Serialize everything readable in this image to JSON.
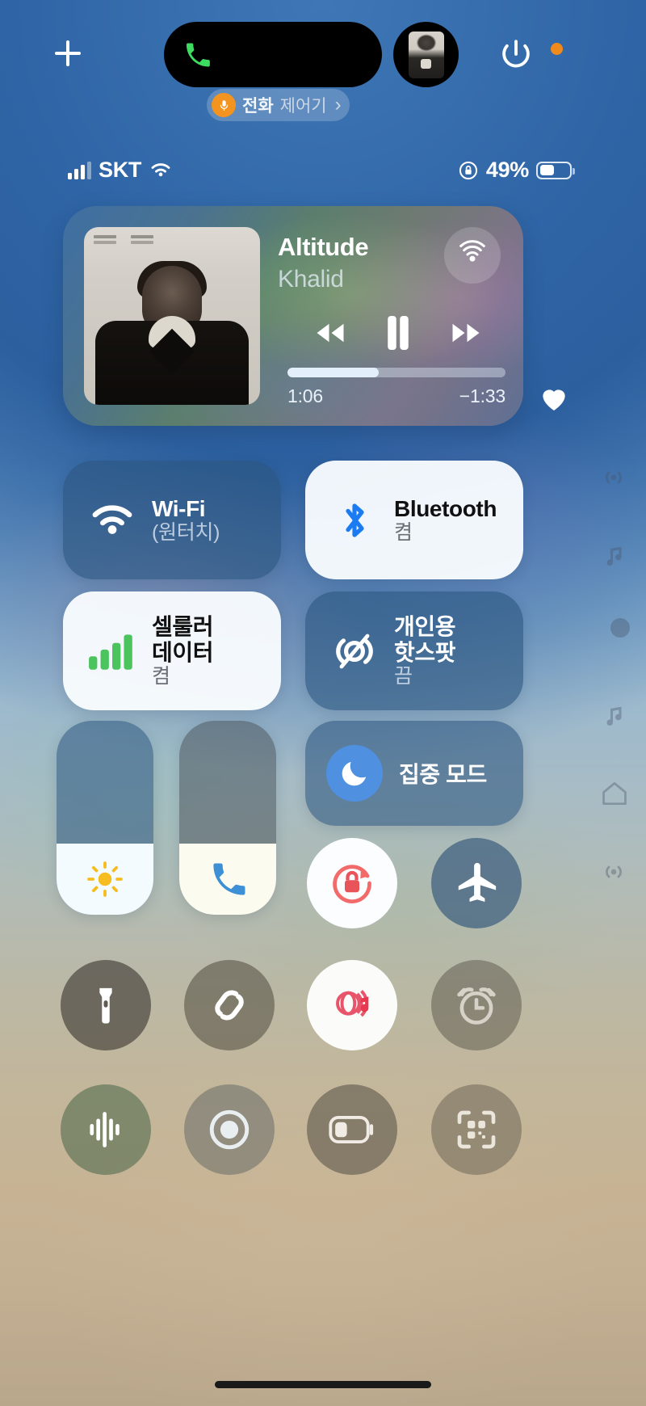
{
  "topbar": {
    "add_button_label": "+",
    "dynamic_island": {
      "name": "phone-call-activity",
      "icon": "phone-icon",
      "avatar": "caller-avatar"
    },
    "power_icon": "power-icon",
    "orange_dot": "microphone-in-use-indicator",
    "phone_pill": {
      "icon": "microphone-icon",
      "label": "전화",
      "sub_label": "제어기",
      "chevron": "›"
    }
  },
  "statusbar": {
    "signal": "cellular-signal-bars",
    "carrier": "SKT",
    "wifi": "wifi-icon",
    "orientation_lock": "rotation-lock-icon",
    "battery_percent": "49%",
    "battery_level": 49
  },
  "media": {
    "title": "Altitude",
    "artist": "Khalid",
    "airplay_icon": "airplay-icon",
    "rewind_icon": "rewind-icon",
    "play_pause_icon": "pause-icon",
    "forward_icon": "fast-forward-icon",
    "elapsed": "1:06",
    "remaining": "−1:33",
    "progress_percent": 42,
    "favorite_icon": "heart-icon"
  },
  "tiles": [
    {
      "id": "wifi",
      "icon": "wifi-icon",
      "name": "Wi-Fi",
      "state": "(원터치)",
      "style": "dark"
    },
    {
      "id": "bluetooth",
      "icon": "bluetooth-icon",
      "name": "Bluetooth",
      "state": "켬",
      "style": "light"
    },
    {
      "id": "cellular",
      "icon": "cellular-bars-icon",
      "name": "셀룰러\n데이터",
      "name_line1": "셀룰러",
      "name_line2": "데이터",
      "state": "켬",
      "style": "light"
    },
    {
      "id": "hotspot",
      "icon": "hotspot-off-icon",
      "name_line1": "개인용",
      "name_line2": "핫스팟",
      "state": "끔",
      "style": "dark"
    }
  ],
  "sliders": [
    {
      "id": "brightness",
      "icon": "brightness-icon",
      "value": 25
    },
    {
      "id": "volume",
      "icon": "phone-icon",
      "value": 25
    }
  ],
  "focus": {
    "icon": "moon-icon",
    "label": "집중 모드"
  },
  "round_buttons": [
    {
      "id": "rotation",
      "icon": "rotation-lock-icon",
      "active": true
    },
    {
      "id": "airplane",
      "icon": "airplane-icon",
      "active": false
    },
    {
      "id": "flashlight",
      "icon": "flashlight-icon",
      "active": false
    },
    {
      "id": "shazam",
      "icon": "shazam-icon",
      "active": false
    },
    {
      "id": "sing",
      "icon": "apple-music-sing-icon",
      "active": true
    },
    {
      "id": "alarm",
      "icon": "alarm-clock-icon",
      "active": false
    },
    {
      "id": "voicememo",
      "icon": "voice-memo-icon",
      "active": false
    },
    {
      "id": "screenrec",
      "icon": "screen-record-icon",
      "active": false
    },
    {
      "id": "lowpower",
      "icon": "low-power-battery-icon",
      "active": false
    },
    {
      "id": "qrcode",
      "icon": "qr-code-scanner-icon",
      "active": false
    }
  ],
  "colors": {
    "accent_blue": "#4f90e0",
    "bluetooth_blue": "#1a7bf2",
    "cellular_green": "#4cc45e",
    "rotation_red": "#f26a6a",
    "sing_red": "#e8384f",
    "orange": "#f08a1d",
    "call_green": "#3ddc61"
  },
  "home_indicator": "home-indicator"
}
